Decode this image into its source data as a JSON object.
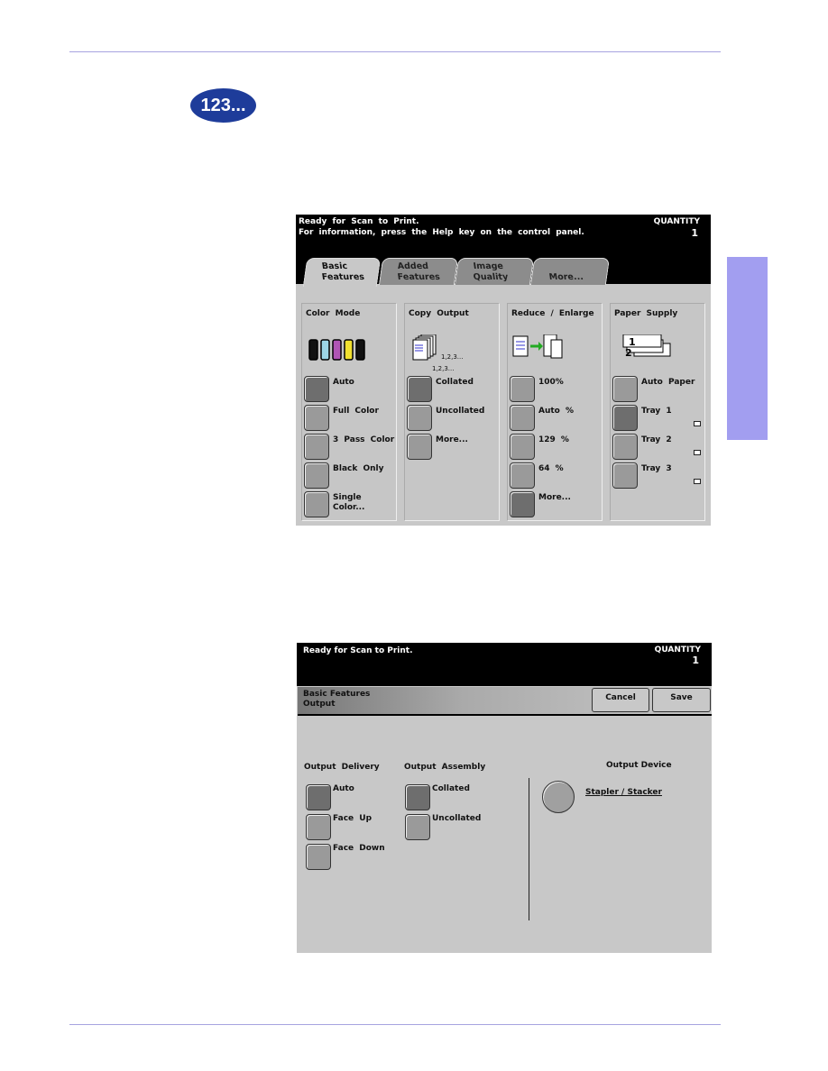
{
  "badge": {
    "text": "1",
    "sub": "2",
    "rest": "3..."
  },
  "screen1": {
    "status_line1": "Ready for Scan to Print.",
    "status_line2": "For information, press the Help key on the control panel.",
    "quantity_label": "QUANTITY",
    "quantity": "1",
    "tabs": [
      {
        "l1": "Basic",
        "l2": "Features"
      },
      {
        "l1": "Added",
        "l2": "Features"
      },
      {
        "l1": "Image",
        "l2": "Quality"
      },
      {
        "l1": "",
        "l2": "More..."
      }
    ],
    "columns": [
      {
        "title": "Color Mode",
        "icon": "toner-bottles-icon",
        "options": [
          {
            "label": "Auto",
            "selected": true
          },
          {
            "label": "Full Color",
            "selected": false
          },
          {
            "label": "3 Pass Color",
            "selected": false
          },
          {
            "label": "Black Only",
            "selected": false
          },
          {
            "label": "Single Color...",
            "selected": false
          }
        ]
      },
      {
        "title": "Copy Output",
        "icon": "collated-pages-icon",
        "icon_text1": "1,2,3...",
        "icon_text2": "1,2,3...",
        "options": [
          {
            "label": "Collated",
            "selected": true
          },
          {
            "label": "Uncollated",
            "selected": false
          },
          {
            "label": "More...",
            "selected": false
          }
        ]
      },
      {
        "title": "Reduce / Enlarge",
        "icon": "reduce-enlarge-icon",
        "options": [
          {
            "label": "100%",
            "selected": false
          },
          {
            "label": "Auto %",
            "selected": false
          },
          {
            "label": "129 %",
            "selected": false
          },
          {
            "label": "64 %",
            "selected": false
          },
          {
            "label": "More...",
            "selected": true
          }
        ]
      },
      {
        "title": "Paper Supply",
        "icon": "paper-trays-icon",
        "options": [
          {
            "label": "Auto Paper",
            "selected": false
          },
          {
            "label": "Tray 1",
            "selected": true
          },
          {
            "label": "Tray 2",
            "selected": false
          },
          {
            "label": "Tray 3",
            "selected": false
          }
        ]
      }
    ]
  },
  "screen2": {
    "status": "Ready for Scan to Print.",
    "quantity_label": "QUANTITY",
    "quantity": "1",
    "title1": "Basic Features",
    "title2": "Output",
    "cancel": "Cancel",
    "save": "Save",
    "delivery": {
      "title": "Output Delivery",
      "options": [
        {
          "label": "Auto",
          "selected": true
        },
        {
          "label": "Face Up",
          "selected": false
        },
        {
          "label": "Face Down",
          "selected": false
        }
      ]
    },
    "assembly": {
      "title": "Output Assembly",
      "options": [
        {
          "label": "Collated",
          "selected": true
        },
        {
          "label": "Uncollated",
          "selected": false
        }
      ]
    },
    "device": {
      "title": "Output Device",
      "option": "Stapler / Stacker"
    }
  },
  "colors": {
    "accent": "#a29ef0",
    "badge": "#1e3c9a"
  }
}
